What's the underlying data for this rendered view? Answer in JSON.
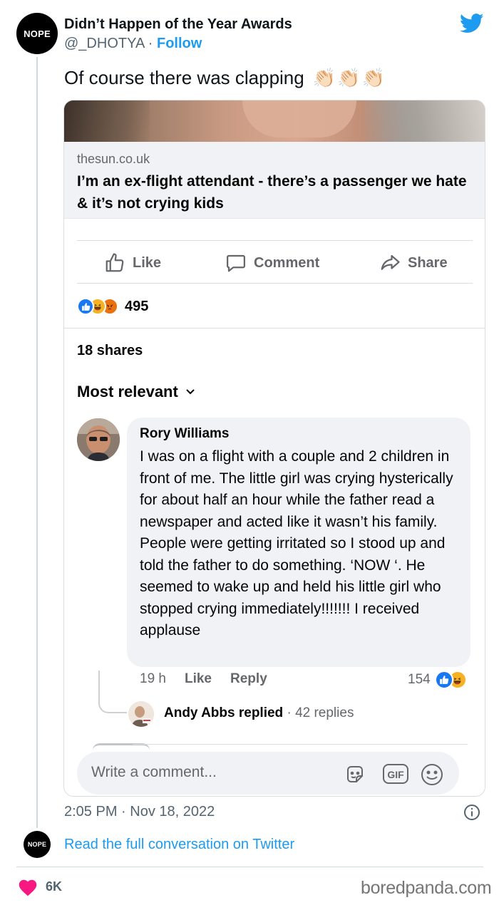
{
  "tweet": {
    "avatar_text": "NOPE",
    "author_name": "Didn’t Happen of the Year Awards",
    "handle": "@_DHOTYA",
    "separator": "·",
    "follow_label": "Follow",
    "text": "Of course there was clapping",
    "clap_emojis": [
      "👏🏻",
      "👏🏻",
      "👏🏻"
    ],
    "timestamp": "2:05 PM · Nov 18, 2022",
    "read_full_label": "Read the full conversation on Twitter",
    "likes_count": "6K",
    "brand_color": "#1d9bf0",
    "heart_color": "#f91880"
  },
  "facebook_post": {
    "link_domain": "thesun.co.uk",
    "link_title": "I’m an ex-flight attendant - there’s a passenger we hate & it’s not crying kids",
    "actions": {
      "like": "Like",
      "comment": "Comment",
      "share": "Share"
    },
    "reactions": [
      "like",
      "haha",
      "angry"
    ],
    "reaction_count": "495",
    "shares": "18 shares",
    "sort_label": "Most relevant",
    "comment": {
      "author": "Rory Williams",
      "text": "I was on a flight with a couple and 2 children in front of me.   The little girl was crying hysterically for about half an hour while the father read a newspaper and acted like it wasn’t his family.   People were getting irritated so I stood up and told the father to do something. ‘NOW ‘. He seemed to wake up and held his little girl who stopped crying immediately!!!!!!!   I received applause",
      "time": "19 h",
      "like_label": "Like",
      "reply_label": "Reply",
      "likes": "154",
      "likes_reactions": [
        "like",
        "haha"
      ]
    },
    "reply_summary": {
      "name": "Andy Abbs",
      "action": "replied",
      "separator": "·",
      "count": "42 replies"
    },
    "write_placeholder": "Write a comment...",
    "gif_label": "GIF"
  },
  "watermark": "boredpanda.com"
}
